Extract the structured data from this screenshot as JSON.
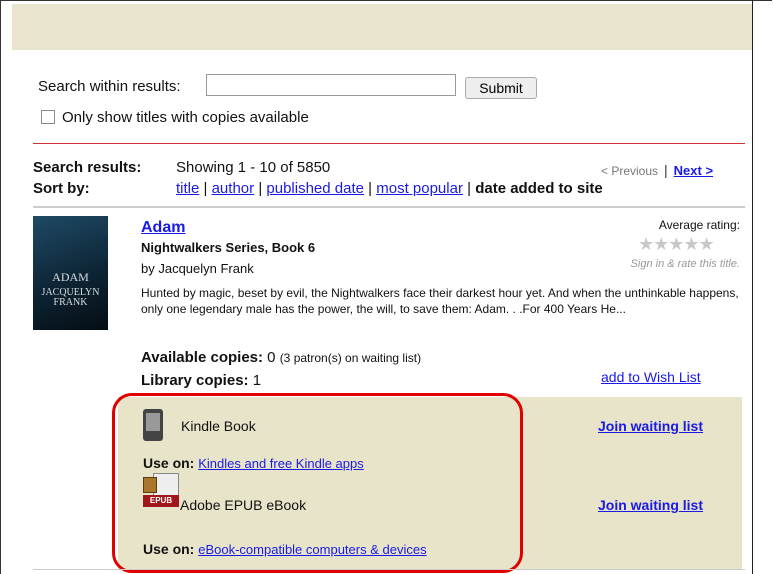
{
  "search": {
    "label": "Search within results:",
    "value": "",
    "placeholder": "",
    "submit_label": "Submit",
    "only_available_label": "Only show titles with copies available"
  },
  "results": {
    "label": "Search results:",
    "showing": "Showing 1 - 10 of 5850",
    "previous": "< Previous",
    "separator": "|",
    "next": "Next >"
  },
  "sort": {
    "label": "Sort by:",
    "options": [
      "title",
      "author",
      "published date",
      "most popular"
    ],
    "current": "date added to site",
    "separator": "|"
  },
  "book": {
    "cover_title": "ADAM",
    "cover_author": "JACQUELYN FRANK",
    "title": "Adam",
    "series": "Nightwalkers Series, Book 6",
    "author": "by Jacquelyn Frank",
    "rating_label": "Average rating:",
    "stars": "★★★★★",
    "rating_count": 0,
    "rate_prompt": "Sign in & rate this title.",
    "description": "Hunted by magic, beset by evil, the Nightwalkers face their darkest hour yet. And when the unthinkable happens, only one legendary male has the power, the will, to save them: Adam. . .For 400 Years He...",
    "available_label": "Available copies:",
    "available_value": "0",
    "waiting_note": "(3 patron(s) on waiting list)",
    "library_label": "Library copies:",
    "library_value": "1",
    "wishlist": "add to Wish List"
  },
  "formats": [
    {
      "icon": "kindle-device-icon",
      "name": "Kindle Book",
      "action": "Join waiting list",
      "use_on_label": "Use on:",
      "use_on_link": "Kindles and free Kindle apps"
    },
    {
      "icon": "epub-ebook-icon",
      "icon_text": "EPUB",
      "name": "Adobe EPUB eBook",
      "action": "Join waiting list",
      "use_on_label": "Use on:",
      "use_on_link": "eBook-compatible computers & devices"
    }
  ],
  "colors": {
    "link": "#1a1ae6",
    "highlight_box": "#e00000",
    "format_panel": "#e8e4c9",
    "top_bar": "#e9e5cf"
  }
}
